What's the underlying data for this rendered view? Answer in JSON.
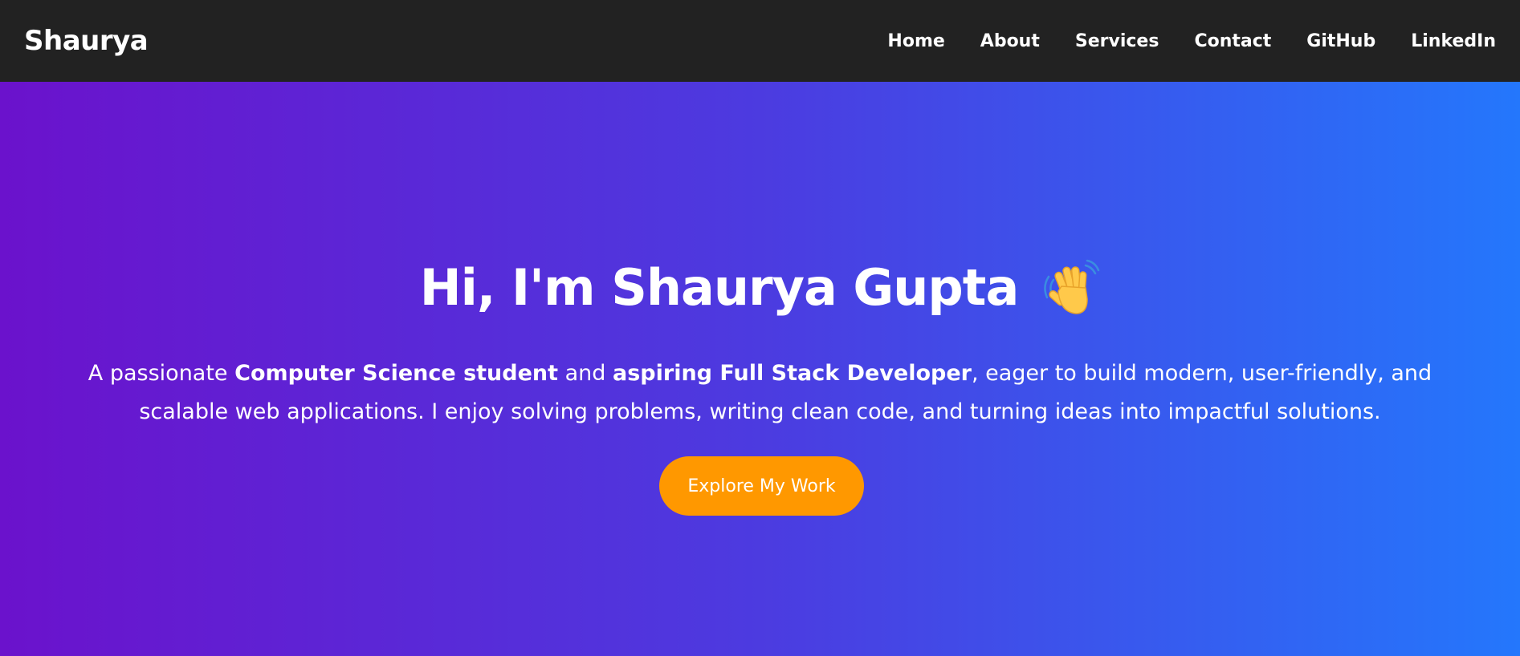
{
  "nav": {
    "brand": "Shaurya",
    "links": [
      {
        "label": "Home"
      },
      {
        "label": "About"
      },
      {
        "label": "Services"
      },
      {
        "label": "Contact"
      },
      {
        "label": "GitHub"
      },
      {
        "label": "LinkedIn"
      }
    ]
  },
  "hero": {
    "title": "Hi, I'm Shaurya Gupta",
    "title_icon": "waving-hand-icon",
    "description": {
      "part1": "A passionate ",
      "bold1": "Computer Science student",
      "part2": " and ",
      "bold2": "aspiring Full Stack Developer",
      "part3": ", eager to build modern, user-friendly, and scalable web applications. I enjoy solving problems, writing clean code, and turning ideas into impactful solutions."
    },
    "cta_label": "Explore My Work"
  },
  "colors": {
    "navbar_bg": "#222222",
    "gradient_start": "#6b12cc",
    "gradient_end": "#2477fc",
    "cta_bg": "#ff9800"
  }
}
